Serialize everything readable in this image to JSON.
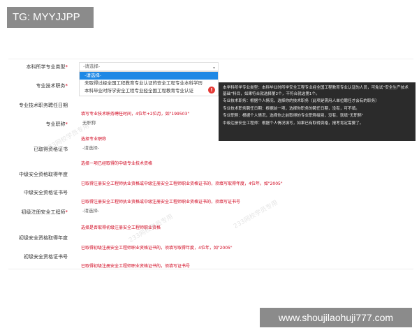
{
  "badges": {
    "top_left": "TG: MYYJJPP",
    "bottom_right": "www.shoujilaohuji777.com"
  },
  "form": {
    "rows": [
      {
        "label": "本科所学专业类型",
        "required": true,
        "value": "-请选择-"
      },
      {
        "label": "专业技术职务",
        "required": true,
        "value": ""
      },
      {
        "label": "专业技术职务聘任日期",
        "required": false,
        "value": ""
      },
      {
        "label": "专业职称",
        "required": true,
        "value": "无职称"
      },
      {
        "label": "已取得资格证书",
        "required": false,
        "value": "-请选择-"
      },
      {
        "label": "中级安全资格取得年度",
        "required": false,
        "value": ""
      },
      {
        "label": "中级安全资格证书号",
        "required": false,
        "value": ""
      },
      {
        "label": "初级注册安全工程师",
        "required": true,
        "value": "-请选择-"
      },
      {
        "label": "初级安全资格取得年度",
        "required": false,
        "value": ""
      },
      {
        "label": "初级安全资格证书号",
        "required": false,
        "value": ""
      }
    ],
    "hints": {
      "appoint_date": "填写专业技术职务聘任时间，4位年+2位月，如\"199503\"",
      "title": "选择专业职称",
      "cert": "选择一项已经取得的中级专业技术资格",
      "mid_year": "已取得注册安全工程师执业资格或中级注册安全工程师职业资格证书的，须填写取得年度，4位年，如\"2005\"",
      "mid_no": "已取得注册安全工程师执业资格或中级注册安全工程师职业资格证书的，须填写证书号",
      "junior": "选择是否取得初级注册安全工程师职业资格",
      "junior_year": "已取得初级注册安全工程师职业资格证书的，须填写取得年度，4位年，如\"2005\"",
      "junior_no": "已取得初级注册安全工程师职业资格证书的，须填写证书号"
    }
  },
  "dropdown": {
    "options": [
      "-请选择-",
      "未取得过经全国工程教育专业认证的安全工程专业本科学历",
      "本科毕业时所学安全工程专业经全国工程教育专业认证"
    ],
    "selected_index": 0
  },
  "tooltip": {
    "info_icon": "!",
    "lines": [
      "本学科所学专业类型：本科毕业时所学安全工程专业经全国工程教育专业认证的人员，可免试“安全生产技术基础”科目，如果符合就选择第2个，不符合就选第1个。",
      "专业技术职务：根据个人情况，选择你的技术职务（此项是需用人单位聘任才会有的职务）",
      "专业技术职务聘任日期：根据前一项，选择你职务的聘任日期，没有，可不填。",
      "专业职称：根据个人情况，选择你之前取得的专业职称级别，没有，就填“无职称”",
      "中级注册安全工程师：根据个人情况填写，如果已有取得资格，报考肯定需要了。"
    ]
  },
  "watermarks": [
    "233网校学员专用",
    "233网校学员专用",
    "233网校学员专用"
  ],
  "colors": {
    "accent": "#1e88e5",
    "error": "#d0021b",
    "badge_bg": "#8b8b8b",
    "tooltip_bg": "#2b2b2b"
  }
}
